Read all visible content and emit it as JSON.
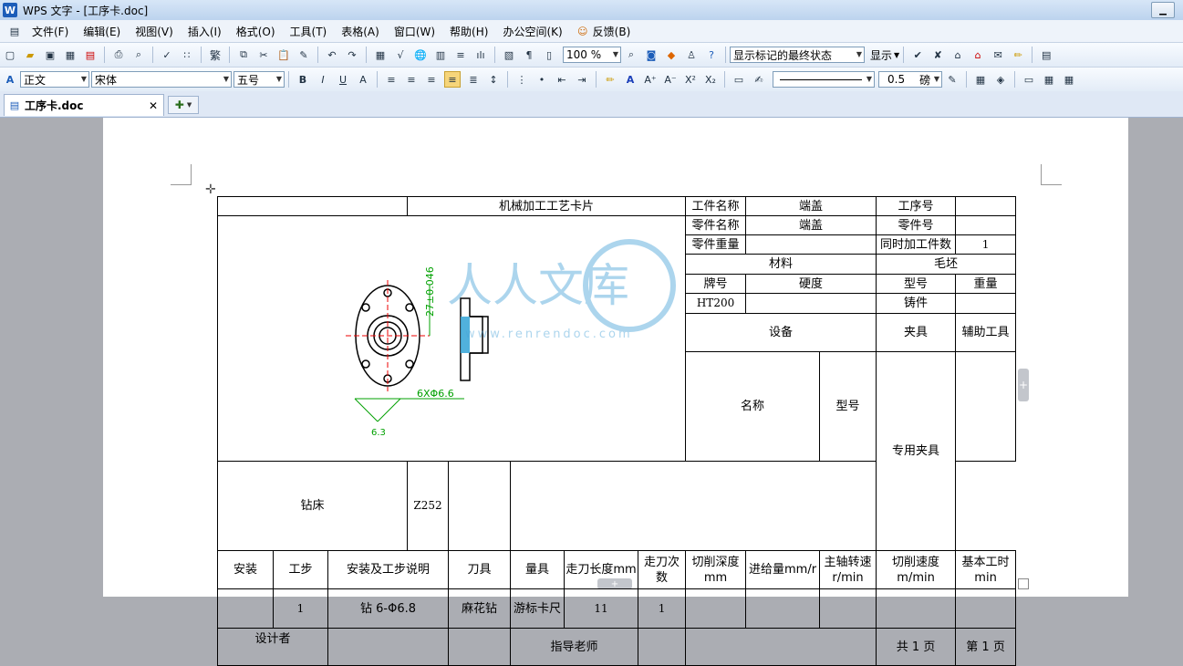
{
  "window": {
    "title": "WPS 文字 - [工序卡.doc]",
    "app_icon": "W"
  },
  "menu": [
    "文件(F)",
    "编辑(E)",
    "视图(V)",
    "插入(I)",
    "格式(O)",
    "工具(T)",
    "表格(A)",
    "窗口(W)",
    "帮助(H)",
    "办公空间(K)",
    "反馈(B)"
  ],
  "toolbar1": {
    "zoom": "100 %",
    "markup_state": "显示标记的最终状态",
    "show_label": "显示"
  },
  "toolbar2": {
    "style": "正文",
    "font": "宋体",
    "size": "五号",
    "line_width": "0.5",
    "line_unit": "磅"
  },
  "tab": {
    "label": "工序卡.doc"
  },
  "watermark": {
    "text": "人人文库",
    "url": "www.renrendoc.com"
  },
  "drawing": {
    "dim_vertical": "27±0.046",
    "dim_holes": "6XΦ6.6",
    "dim_roughness": "6.3"
  },
  "card": {
    "title": "机械加工工艺卡片",
    "workpiece_name_label": "工件名称",
    "workpiece_name": "端盖",
    "op_no_label": "工序号",
    "op_no": "",
    "part_name_label": "零件名称",
    "part_name": "端盖",
    "part_no_label": "零件号",
    "part_no": "",
    "part_weight_label": "零件重量",
    "part_weight": "",
    "simul_label": "同时加工件数",
    "simul": "1",
    "material_label": "材料",
    "blank_label": "毛坯",
    "grade_label": "牌号",
    "hardness_label": "硬度",
    "type_label": "型号",
    "weight_label": "重量",
    "grade": "HT200",
    "hardness": "",
    "blank_type": "铸件",
    "blank_weight": "",
    "equip_label": "设备",
    "fixture_label": "夹具",
    "aux_label": "辅助工具",
    "equip_name_label": "名称",
    "equip_model_label": "型号",
    "equip_name": "钻床",
    "equip_model": "Z252",
    "fixture": "专用夹具",
    "aux": "",
    "headers": [
      "安装",
      "工步",
      "安装及工步说明",
      "刀具",
      "量具",
      "走刀长度mm",
      "走刀次数",
      "切削深度 mm",
      "进给量mm/r",
      "主轴转速r/min",
      "切削速度m/min",
      "基本工时 min"
    ],
    "step": {
      "install": "",
      "step": "1",
      "desc": "钻 6-Φ6.8",
      "tool": "麻花钻",
      "gauge": "游标卡尺",
      "length": "11",
      "passes": "1",
      "depth": "",
      "feed": "",
      "speed": "",
      "velocity": "",
      "time": ""
    },
    "designer_label": "设计者",
    "advisor_label": "指导老师",
    "total_pages": "共 1 页",
    "page_no": "第 1 页"
  }
}
